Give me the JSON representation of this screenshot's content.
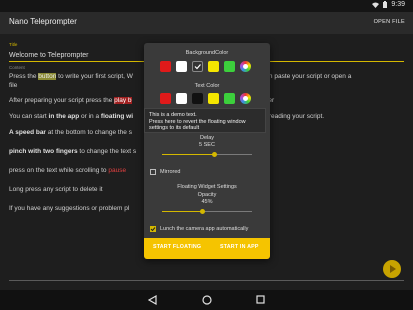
{
  "status": {
    "time": "9:39"
  },
  "app": {
    "title": "Nano Teleprompter",
    "open_file": "OPEN FILE"
  },
  "title_field": {
    "label": "Title",
    "value": "Welcome to Teleprompter"
  },
  "content_field": {
    "label": "Content"
  },
  "content": {
    "l1_a": "Press the ",
    "l1_b": "button",
    "l1_c": " to write your first script, W",
    "l1_d": "it, you can paste your script or open a",
    "l1_e": "file",
    "l2_a": "After preparing your script press the ",
    "l2_b": "play b",
    "l2_c": "mpter",
    "l3_a": "You can start ",
    "l3_b": "in the app",
    "l3_c": " or in a ",
    "l3_d": "floating wi",
    "l3_e": "ke the camera) while reading your script.",
    "l4_a": "A speed bar",
    "l4_b": " at the bottom to change the s",
    "l5_a": "pinch with two fingers",
    "l5_b": " to change the text s",
    "l6_a": "press on the text while scrolling to ",
    "l6_b": "pause",
    "l7": "Long press any script to delete it",
    "l8_a": "If you have any suggestions or problem pl",
    "l8_b": "om"
  },
  "dialog": {
    "bg_color_label": "BackgroundColor",
    "bg_colors": [
      "#e01a1a",
      "#ffffff",
      "#333333",
      "#f5e600",
      "#3cd03c"
    ],
    "text_color_label": "Text Color",
    "text_colors": [
      "#e01a1a",
      "#ffffff",
      "#111111",
      "#f5e600",
      "#3cd03c"
    ],
    "tooltip_line1": "This is a demo text.",
    "tooltip_line2": "Press here to revert the floating window",
    "tooltip_line3": "settings to its default",
    "delay_label": "Delay",
    "delay_value": "5 SEC",
    "delay_level": 0.58,
    "mirrored_label": "Mirrored",
    "floating_label": "Floating Widget Settings",
    "opacity_label": "Opacity",
    "opacity_value": "45%",
    "opacity_level": 0.45,
    "camera_label": "Lunch the camera app automatically",
    "start_floating": "START FLOATING",
    "start_in_app": "START IN APP"
  }
}
